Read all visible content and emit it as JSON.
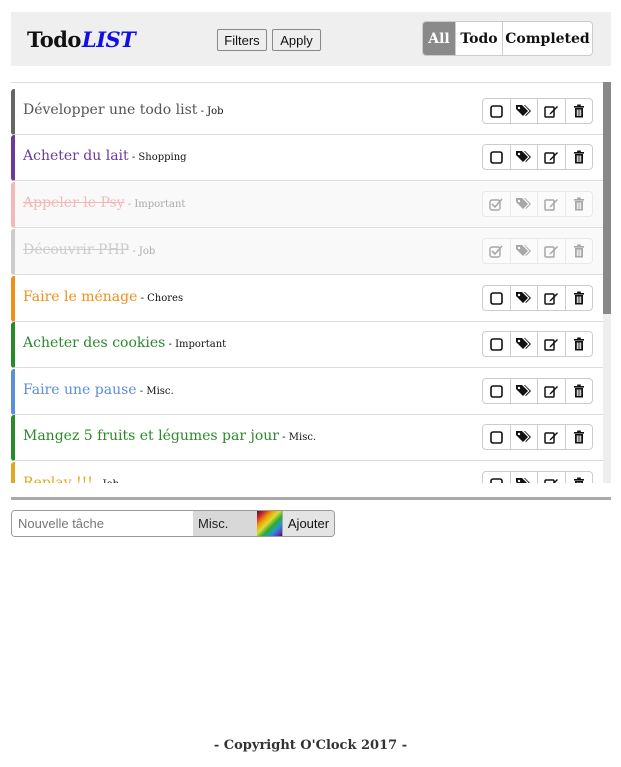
{
  "header": {
    "logo_main": "Todo",
    "logo_accent": "LIST",
    "filters_label": "Filters",
    "apply_label": "Apply",
    "views": [
      {
        "label": "All",
        "active": true
      },
      {
        "label": "Todo",
        "active": false
      },
      {
        "label": "Completed",
        "active": false
      }
    ]
  },
  "tasks": [
    {
      "title": "Développer une todo list",
      "category": "Job",
      "color": "#666666",
      "done": false
    },
    {
      "title": "Acheter du lait",
      "category": "Shopping",
      "color": "#6a3a9c",
      "done": false
    },
    {
      "title": "Appeler le Psy",
      "category": "Important",
      "color": "#f4b8b8",
      "done": true
    },
    {
      "title": "Découvrir PHP",
      "category": "Job",
      "color": "#cccccc",
      "done": true
    },
    {
      "title": "Faire le ménage",
      "category": "Chores",
      "color": "#f0901a",
      "done": false
    },
    {
      "title": "Acheter des cookies",
      "category": "Important",
      "color": "#2a8a2a",
      "done": false
    },
    {
      "title": "Faire une pause",
      "category": "Misc.",
      "color": "#5a8fdb",
      "done": false
    },
    {
      "title": "Mangez 5 fruits et légumes par jour",
      "category": "Misc.",
      "color": "#2a8a2a",
      "done": false
    },
    {
      "title": "Replay !!!",
      "category": "Job",
      "color": "#e0a820",
      "done": false
    }
  ],
  "task_icons": [
    "checkbox-icon",
    "tags-icon",
    "edit-icon",
    "trash-icon"
  ],
  "form": {
    "placeholder": "Nouvelle tâche",
    "category": "Misc.",
    "add_label": "Ajouter"
  },
  "footer": {
    "text": "- Copyright O'Clock 2017 -"
  }
}
